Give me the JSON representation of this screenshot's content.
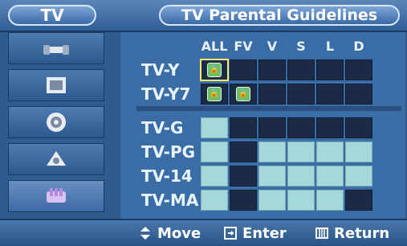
{
  "header": {
    "section": "TV",
    "title": "TV Parental Guidelines"
  },
  "columns": [
    "ALL",
    "FV",
    "V",
    "S",
    "L",
    "D"
  ],
  "rows_group1": [
    {
      "label": "TV-Y",
      "cells": [
        "lock",
        "dark",
        "dark",
        "dark",
        "dark",
        "dark"
      ],
      "selected_col": 0
    },
    {
      "label": "TV-Y7",
      "cells": [
        "lock",
        "lock",
        "dark",
        "dark",
        "dark",
        "dark"
      ]
    }
  ],
  "rows_group2": [
    {
      "label": "TV-G",
      "cells": [
        "light",
        "dark",
        "dark",
        "dark",
        "dark",
        "dark"
      ]
    },
    {
      "label": "TV-PG",
      "cells": [
        "light",
        "dark",
        "light",
        "light",
        "light",
        "light"
      ]
    },
    {
      "label": "TV-14",
      "cells": [
        "light",
        "dark",
        "light",
        "light",
        "light",
        "light"
      ]
    },
    {
      "label": "TV-MA",
      "cells": [
        "light",
        "dark",
        "light",
        "light",
        "light",
        "dark"
      ]
    }
  ],
  "sidebar": {
    "items": [
      {
        "name": "input-icon"
      },
      {
        "name": "picture-icon"
      },
      {
        "name": "sound-icon"
      },
      {
        "name": "channel-icon"
      },
      {
        "name": "setup-icon"
      }
    ]
  },
  "footer": {
    "move": "Move",
    "enter": "Enter",
    "return": "Return"
  },
  "colors": {
    "locked": "#6bbf6c",
    "unlocked_block": "#a6d8db",
    "empty": "#1b2b45",
    "selection": "#ffe96a"
  }
}
